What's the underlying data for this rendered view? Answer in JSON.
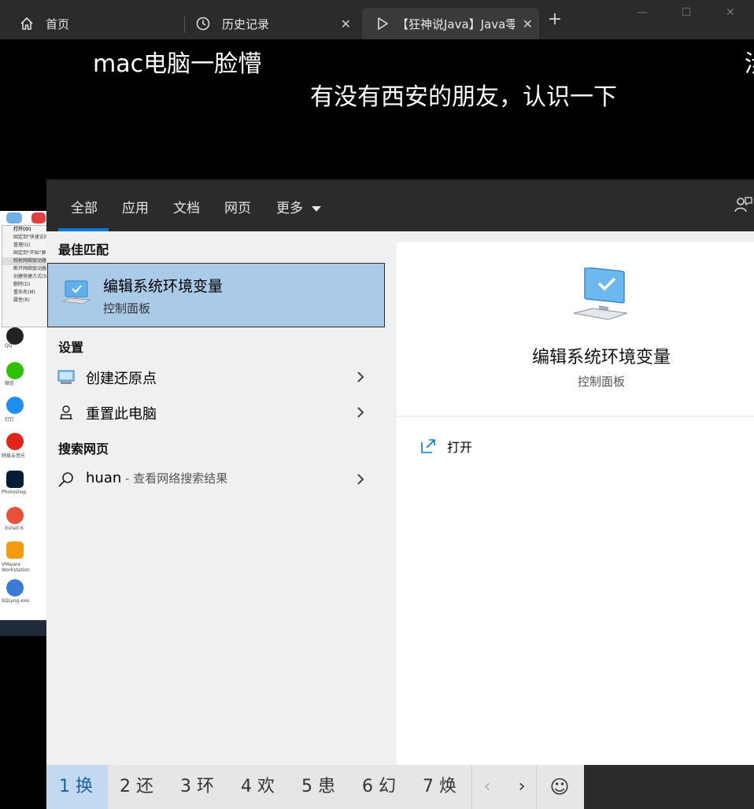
{
  "browser": {
    "tabs": [
      {
        "label": "首页",
        "icon": "home-icon"
      },
      {
        "label": "历史记录",
        "icon": "history-icon"
      },
      {
        "label": "【狂神说Java】Java零",
        "icon": "play-icon"
      }
    ],
    "new_tab": "+"
  },
  "video": {
    "danmaku": [
      "mac电脑一脸懵",
      "有没有西安的朋友，认识一下",
      "涉"
    ]
  },
  "desktop_thumbnail": {
    "context_menu": [
      "打开(O)",
      "固定到\"快速访问\"",
      "管理(G)",
      "固定到\"开始\"屏幕",
      "映射网络驱动器",
      "断开网络驱动器",
      "创建快捷方式(S)",
      "删除(D)",
      "重命名(M)",
      "属性(R)"
    ],
    "icons": [
      "QQ",
      "微信",
      "钉钉",
      "网易云音乐",
      "Photoshop",
      "Xshell 6",
      "VMware Workstation",
      "SQLyog.exe"
    ]
  },
  "search": {
    "tabs": [
      "全部",
      "应用",
      "文档",
      "网页",
      "更多"
    ],
    "sections": {
      "best_match": "最佳匹配",
      "settings": "设置",
      "web": "搜索网页"
    },
    "best_match": {
      "title": "编辑系统环境变量",
      "subtitle": "控制面板"
    },
    "settings_items": [
      {
        "label": "创建还原点"
      },
      {
        "label": "重置此电脑"
      }
    ],
    "web_item": {
      "query": "huan",
      "hint": " - 查看网络搜索结果"
    },
    "detail": {
      "title": "编辑系统环境变量",
      "subtitle": "控制面板",
      "open_label": "打开"
    }
  },
  "ime": {
    "candidates": [
      "1 换",
      "2 还",
      "3 环",
      "4 欢",
      "5 患",
      "6 幻",
      "7 焕"
    ],
    "prev": "‹",
    "next": "›",
    "emoji": "☺"
  },
  "colors": {
    "accent": "#0a78d4",
    "selection": "#a9cbe8",
    "panel_dark": "#2b2b2b",
    "panel_light": "#f0f0f0"
  }
}
